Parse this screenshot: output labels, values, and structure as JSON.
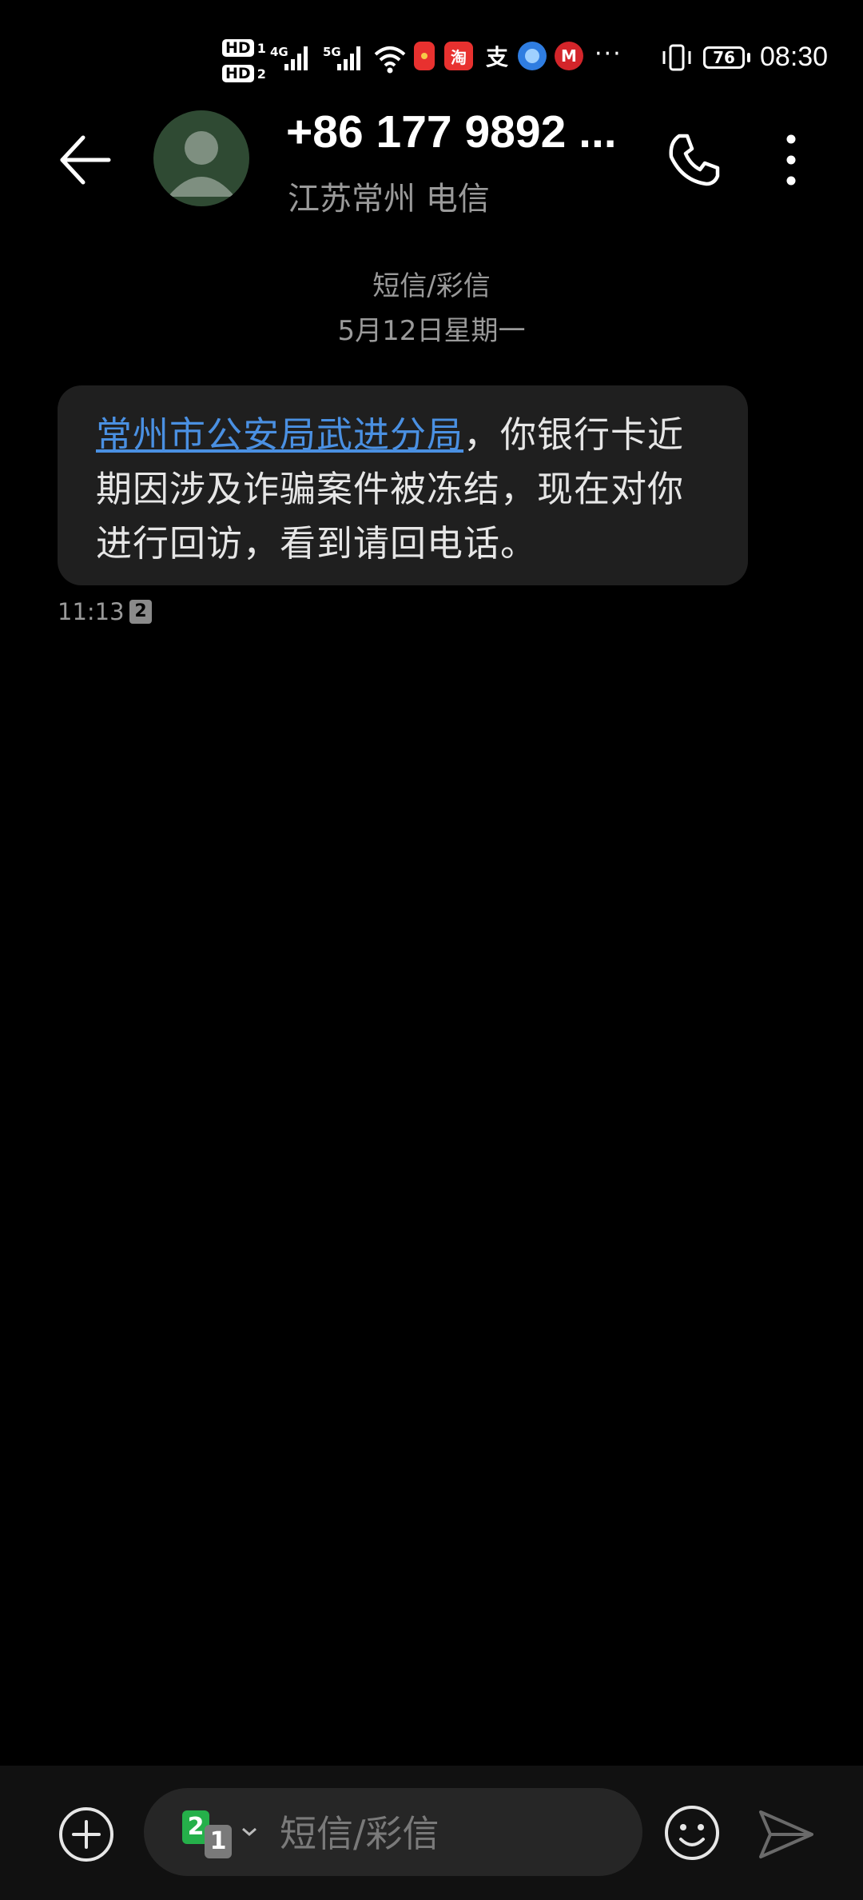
{
  "status_bar": {
    "sim1_label": "HD",
    "sim1_num": "1",
    "sim2_label": "HD",
    "sim2_num": "2",
    "net1": "4G",
    "net2": "5G",
    "app_icons": [
      "red-envelope-icon",
      "taobao-icon",
      "alipay-icon",
      "browser-icon",
      "cmb-bank-icon"
    ],
    "more": "···",
    "battery": "76",
    "time": "08:30"
  },
  "header": {
    "contact_name": "+86 177 9892 ...",
    "contact_sub": "江苏常州 电信"
  },
  "conversation": {
    "type_label": "短信/彩信",
    "date_label": "5月12日星期一"
  },
  "message": {
    "link_text": "常州市公安局武进分局",
    "body_text": "，你银行卡近期因涉及诈骗案件被冻结，现在对你进行回访，看到请回电话。",
    "time": "11:13",
    "sim_tag": "2"
  },
  "composer": {
    "sim_primary": "2",
    "sim_secondary": "1",
    "placeholder": "短信/彩信"
  },
  "colors": {
    "background": "#000000",
    "bubble": "#1f1f1f",
    "link": "#4a90e2",
    "secondary_text": "#9a9a9a",
    "sim_green": "#25b04a"
  }
}
